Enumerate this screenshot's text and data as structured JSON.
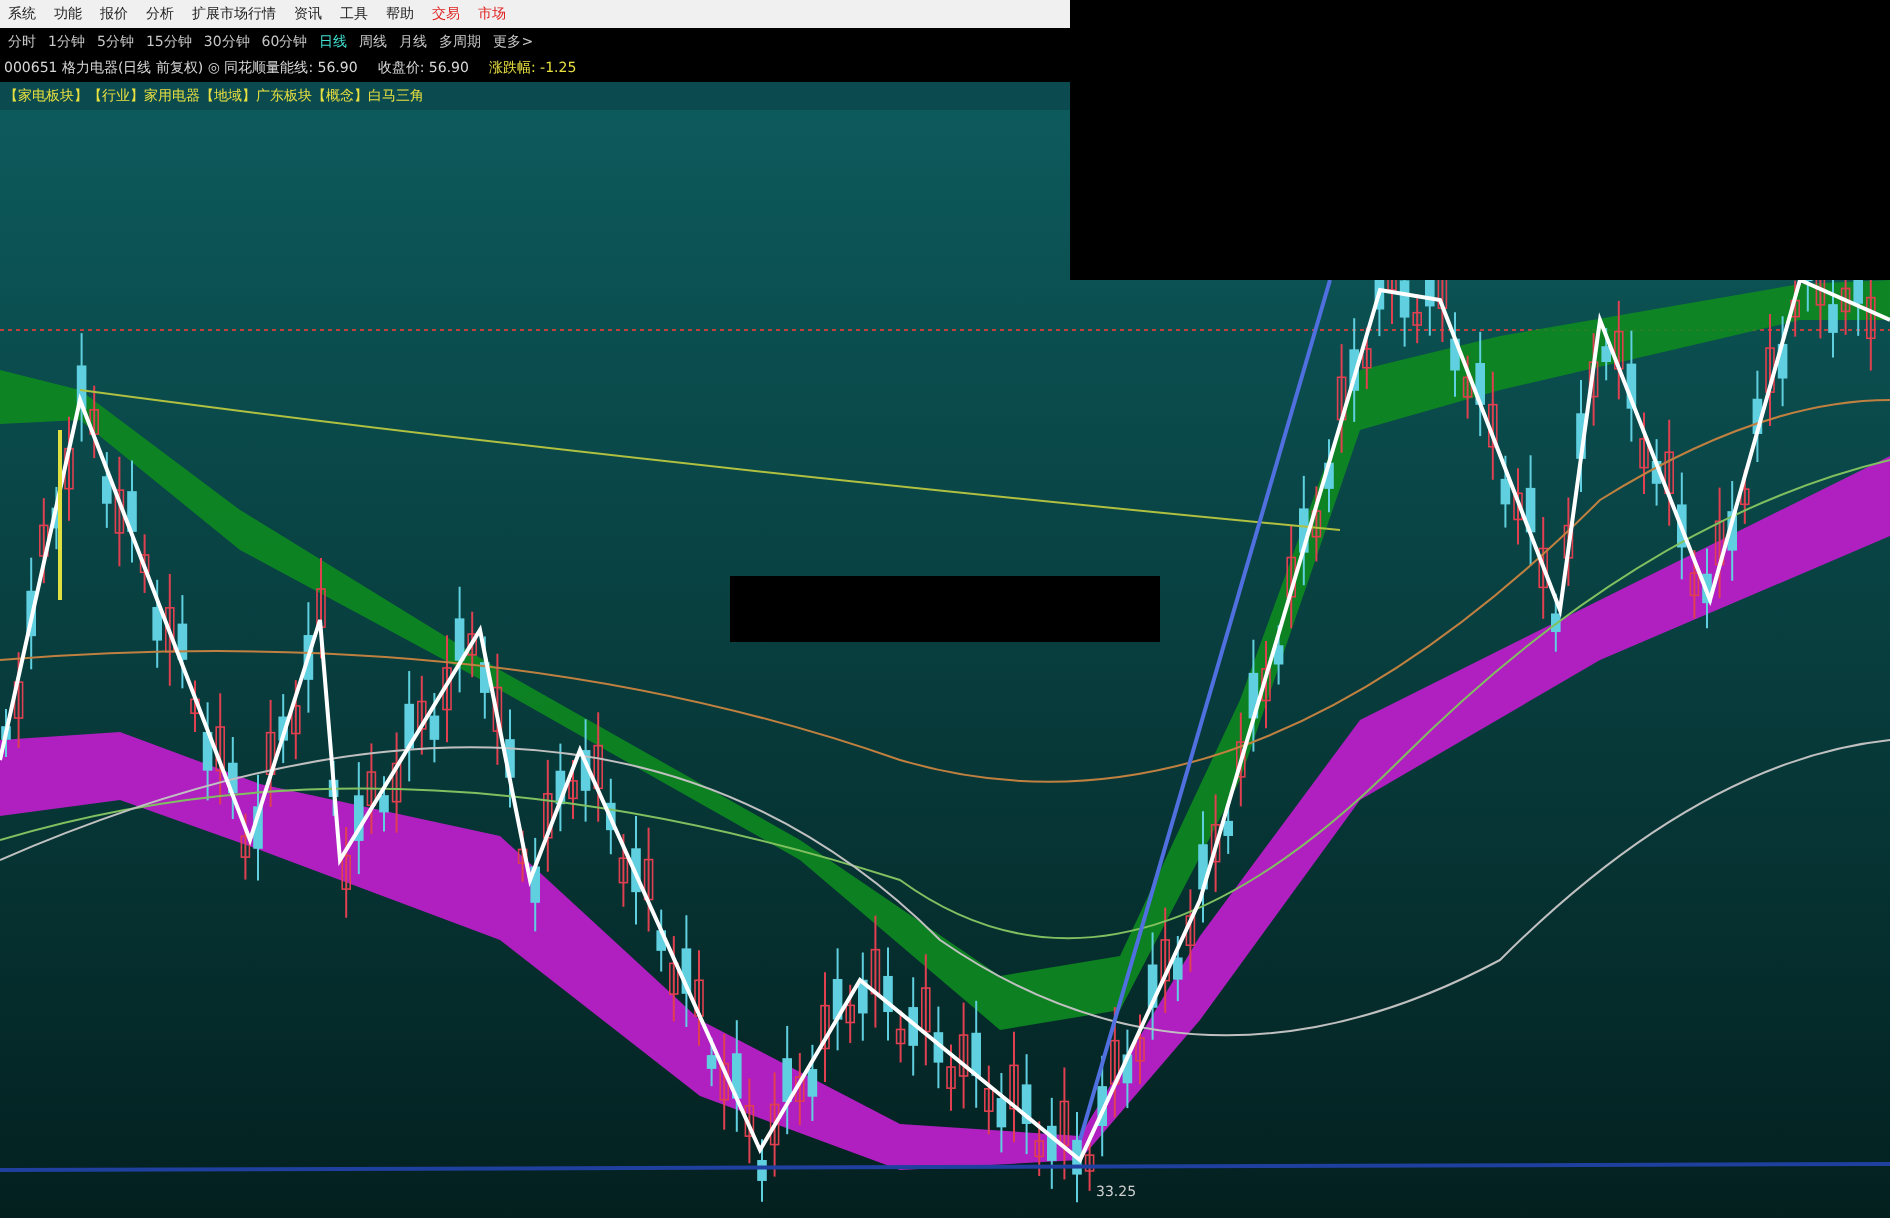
{
  "menu": [
    {
      "label": "系统",
      "highlight": false
    },
    {
      "label": "功能",
      "highlight": false
    },
    {
      "label": "报价",
      "highlight": false
    },
    {
      "label": "分析",
      "highlight": false
    },
    {
      "label": "扩展市场行情",
      "highlight": false
    },
    {
      "label": "资讯",
      "highlight": false
    },
    {
      "label": "工具",
      "highlight": false
    },
    {
      "label": "帮助",
      "highlight": false
    },
    {
      "label": "交易",
      "highlight": true
    },
    {
      "label": "市场",
      "highlight": true
    }
  ],
  "periods": [
    {
      "label": "分时",
      "selected": false
    },
    {
      "label": "1分钟",
      "selected": false
    },
    {
      "label": "5分钟",
      "selected": false
    },
    {
      "label": "15分钟",
      "selected": false
    },
    {
      "label": "30分钟",
      "selected": false
    },
    {
      "label": "60分钟",
      "selected": false
    },
    {
      "label": "日线",
      "selected": true
    },
    {
      "label": "周线",
      "selected": false
    },
    {
      "label": "月线",
      "selected": false
    },
    {
      "label": "多周期",
      "selected": false
    },
    {
      "label": "更多>",
      "selected": false
    }
  ],
  "info": [
    {
      "text": "000651 格力电器(日线 前复权) ◎ 同花顺量能线: 56.90",
      "color": "#d8d8d8"
    },
    {
      "text": "收盘价: 56.90",
      "color": "#d8d8d8"
    },
    {
      "text": "涨跌幅: -1.25",
      "color": "#e8e040"
    }
  ],
  "tags": "【家电板块】【行业】家用电器【地域】广东板块【概念】白马三角",
  "chart": {
    "low_label": "33.25"
  }
}
